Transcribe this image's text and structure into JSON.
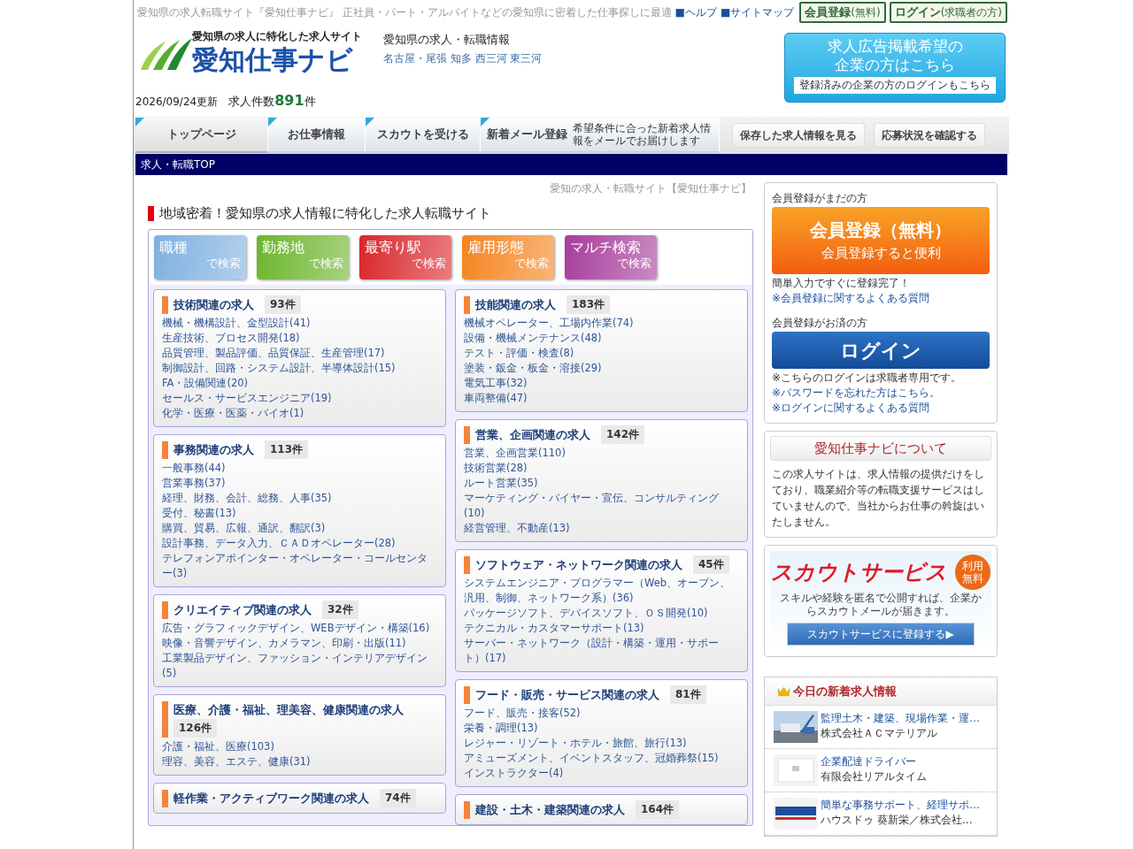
{
  "top_bar": {
    "tagline": "愛知県の求人転職サイト『愛知仕事ナビ』 正社員・パート・アルバイトなどの愛知県に密着した仕事探しに最適",
    "links": [
      "■ヘルプ",
      "■サイトマップ"
    ],
    "buttons": [
      {
        "label": "会員登録",
        "note": "(無料)"
      },
      {
        "label": "ログイン",
        "note": "(求職者の方)"
      }
    ]
  },
  "header": {
    "logo_tagline": "愛知県の求人に特化した求人サイト",
    "logo_name": "愛知仕事ナビ",
    "subtitle": "愛知県の求人・転職情報",
    "regions": "名古屋・尾張 知多 西三河 東三河",
    "employer_banner": {
      "lines": [
        "求人広告掲載希望の",
        "企業の方はこちら"
      ],
      "login": "登録済みの企業の方のログインもこちら"
    },
    "updated": "2026/09/24更新",
    "count_label": "求人件数",
    "count": "891",
    "count_unit": "件"
  },
  "nav": {
    "tabs": [
      {
        "label": "トップページ",
        "selected": true
      },
      {
        "label": "お仕事情報",
        "selected": false
      },
      {
        "label": "スカウトを受ける",
        "selected": false
      },
      {
        "label": "新着メール登録",
        "note": "希望条件に合った新着求人情報をメールでお届けします",
        "selected": false
      }
    ],
    "buttons": [
      "保存した求人情報を見る",
      "応募状況を確認する"
    ]
  },
  "breadcrumb": "求人・転職TOP",
  "main": {
    "site_caption": "愛知の求人・転職サイト【愛知仕事ナビ】",
    "heading": "地域密着！愛知県の求人情報に特化した求人転職サイト",
    "search_buttons": [
      {
        "label": "職種",
        "sub": "で検索",
        "color": "#7fb0e0"
      },
      {
        "label": "勤務地",
        "sub": "で検索",
        "color": "#6cb52c"
      },
      {
        "label": "最寄り駅",
        "sub": "で検索",
        "color": "#d9262a"
      },
      {
        "label": "雇用形態",
        "sub": "で検索",
        "color": "#f5841f"
      },
      {
        "label": "マルチ検索",
        "sub": "で検索",
        "color": "#a63d9c"
      }
    ],
    "columns": [
      [
        {
          "title": "技術関連の求人",
          "count": "93件",
          "links": [
            "機械・機構設計、金型設計(41)",
            "生産技術、プロセス開発(18)",
            "品質管理、製品評価、品質保証、生産管理(17)",
            "制御設計、回路・システム設計、半導体設計(15)",
            "FA・設備関連(20)",
            "セールス・サービスエンジニア(19)",
            "化学・医療・医薬・バイオ(1)"
          ]
        },
        {
          "title": "事務関連の求人",
          "count": "113件",
          "links": [
            "一般事務(44)",
            "営業事務(37)",
            "経理、財務、会計、総務、人事(35)",
            "受付、秘書(13)",
            "購買、貿易、広報、通訳、翻訳(3)",
            "設計事務、データ入力、ＣＡＤオペレーター(28)",
            "テレフォンアポインター・オペレーター・コールセンター(3)"
          ]
        },
        {
          "title": "クリエイティブ関連の求人",
          "count": "32件",
          "links": [
            "広告・グラフィックデザイン、WEBデザイン・構築(16)",
            "映像・音響デザイン、カメラマン、印刷・出版(11)",
            "工業製品デザイン、ファッション・インテリアデザイン(5)"
          ]
        },
        {
          "title": "医療、介護・福祉、理美容、健康関連の求人",
          "count": "126件",
          "links": [
            "介護・福祉、医療(103)",
            "理容、美容、エステ、健康(31)"
          ]
        },
        {
          "title": "軽作業・アクティブワーク関連の求人",
          "count": "74件"
        }
      ],
      [
        {
          "title": "技能関連の求人",
          "count": "183件",
          "links": [
            "機械オペレーター、工場内作業(74)",
            "設備・機械メンテナンス(48)",
            "テスト・評価・検査(8)",
            "塗装・鈑金・板金・溶接(29)",
            "電気工事(32)",
            "車両整備(47)"
          ]
        },
        {
          "title": "営業、企画関連の求人",
          "count": "142件",
          "links": [
            "営業、企画営業(110)",
            "技術営業(28)",
            "ルート営業(35)",
            "マーケティング・バイヤー・宣伝、コンサルティング(10)",
            "経営管理、不動産(13)"
          ]
        },
        {
          "title": "ソフトウェア・ネットワーク関連の求人",
          "count": "45件",
          "links": [
            "システムエンジニア・プログラマー（Web、オープン、汎用、制御、ネットワーク系）(36)",
            "パッケージソフト、デバイスソフト、ＯＳ開発(10)",
            "テクニカル・カスタマーサポート(13)",
            "サーバー・ネットワーク（設計・構築・運用・サポート）(17)"
          ]
        },
        {
          "title": "フード・販売・サービス関連の求人",
          "count": "81件",
          "links": [
            "フード、販売・接客(52)",
            "栄養・調理(13)",
            "レジャー・リゾート・ホテル・旅館、旅行(13)",
            "アミューズメント、イベントスタッフ、冠婚葬祭(15)",
            "インストラクター(4)"
          ]
        },
        {
          "title": "建設・土木・建築関連の求人",
          "count": "164件"
        }
      ]
    ]
  },
  "sidebar": {
    "member": {
      "new_label": "会員登録がまだの方",
      "register_title": "会員登録（無料）",
      "register_sub": "会員登録すると便利",
      "register_note": "簡単入力ですぐに登録完了！",
      "register_faq": "※会員登録に関するよくある質問",
      "existing_label": "会員登録がお済の方",
      "login": "ログイン",
      "login_note": "※こちらのログインは求職者専用です。",
      "login_links": [
        "※パスワードを忘れた方はこちら。",
        "※ログインに関するよくある質問"
      ]
    },
    "about": {
      "title": "愛知仕事ナビについて",
      "body": "この求人サイトは、求人情報の提供だけをしており、職業紹介等の転職支援サービスはしていませんので、当社からお仕事の斡旋はいたしません。"
    },
    "scout": {
      "title": "スカウトサービス",
      "badge": "利用無料",
      "body": "スキルや経験を匿名で公開すれば、企業からスカウトメールが届きます。",
      "button": "スカウトサービスに登録する▶"
    },
    "new_jobs": {
      "title": "今日の新着求人情報",
      "items": [
        {
          "title": "監理土木・建築、現場作業・運…",
          "company": "株式会社ＡＣマテリアル"
        },
        {
          "title": "企業配達ドライバー",
          "company": "有限会社リアルタイム"
        },
        {
          "title": "簡単な事務サポート、経理サポ…",
          "company": "ハウスドゥ 葵新栄／株式会社…"
        }
      ]
    }
  }
}
